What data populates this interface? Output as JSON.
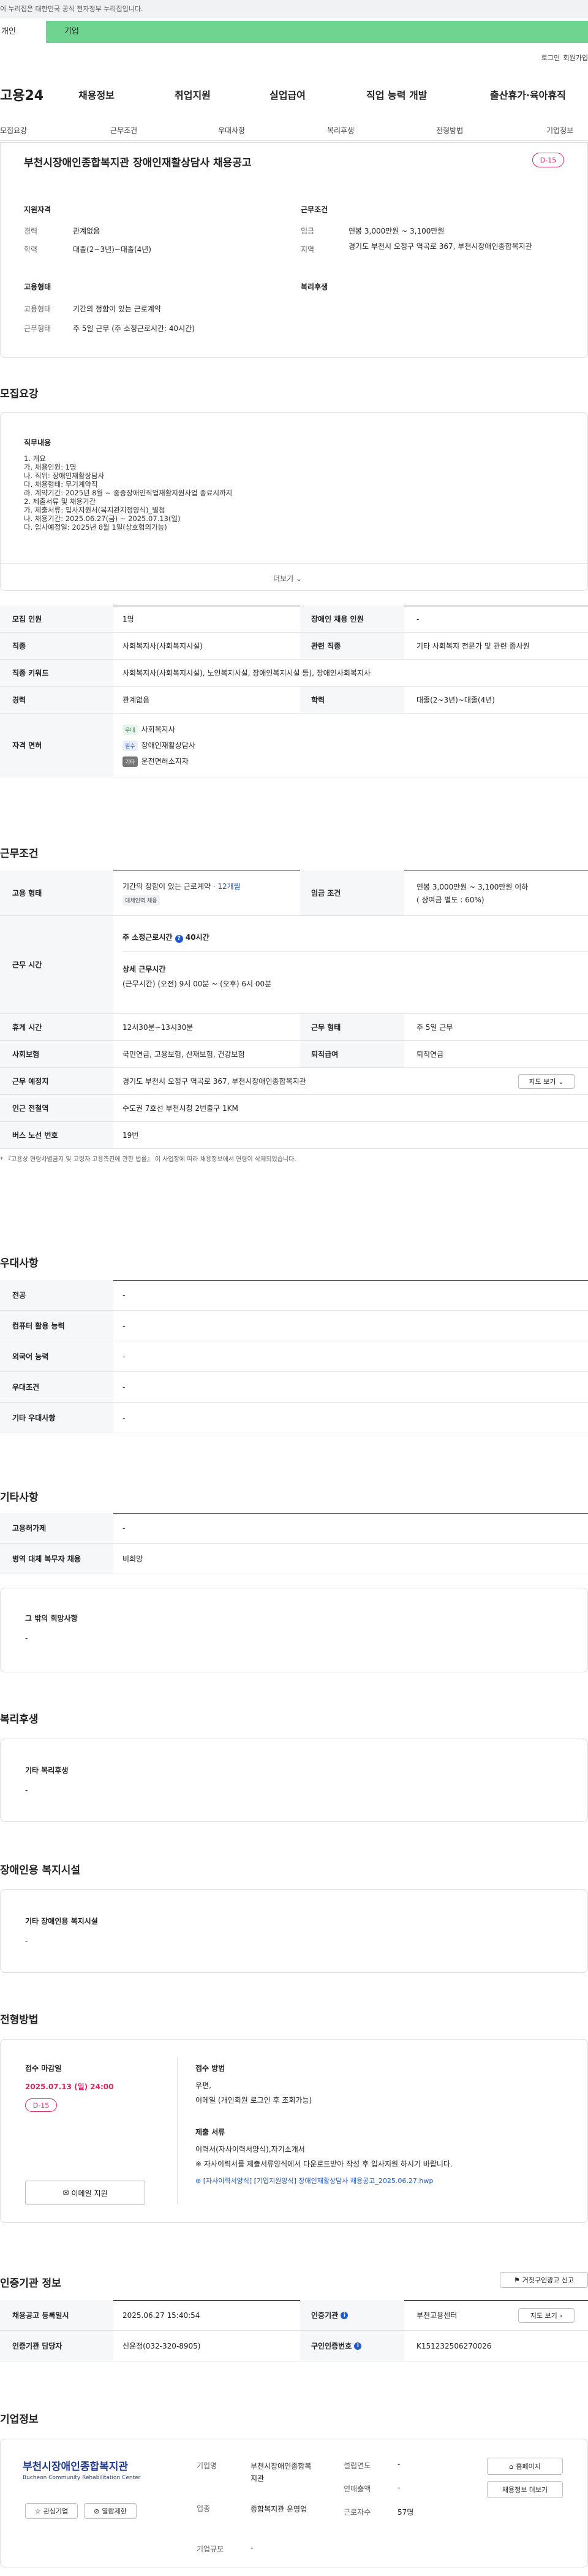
{
  "gov_banner": "이 누리집은 대한민국 공식 전자정부 누리집입니다.",
  "top_tabs": {
    "personal": "개인",
    "business": "기업"
  },
  "util": {
    "login": "로그인",
    "join": "회원가입"
  },
  "gnb": {
    "logo": "고용24",
    "menus": [
      "채용정보",
      "취업지원",
      "실업급여",
      "직업 능력 개발",
      "출산휴가·육아휴직"
    ]
  },
  "subnav": [
    "모집요강",
    "근무조건",
    "우대사항",
    "복리후생",
    "전형방법",
    "기업정보"
  ],
  "summary": {
    "title": "부천시장애인종합복지관 장애인재활상담사 채용공고",
    "dday": "D-15",
    "qual_head": "지원자격",
    "career_label": "경력",
    "career": "관계없음",
    "edu_label": "학력",
    "edu": "대졸(2~3년)~대졸(4년)",
    "cond_head": "근무조건",
    "wage_label": "임금",
    "wage": "연봉 3,000만원 ~ 3,100만원",
    "area_label": "지역",
    "area": "경기도 부천시 오정구 역곡로 367, 부천시장애인종합복지관",
    "type_head": "고용형태",
    "emp_label": "고용형태",
    "emp": "기간의 정함이 있는 근로계약",
    "work_label": "근무형태",
    "work": "주 5일 근무 (주 소정근로시간: 40시간)",
    "welfare_head": "복리후생"
  },
  "recruit": {
    "heading": "모집요강",
    "job_head": "직무내용",
    "lines": [
      "1. 개요",
      "가. 채용인원: 1명",
      "나. 직위: 장애인재활상담사",
      "다. 채용형태: 무기계약직",
      "라. 계약기간: 2025년 8월 ~ 중증장애인직업재활지원사업 종료시까지",
      "2. 제출서류 및 채용기간",
      "가. 제출서류: 입사지원서(복지관지정양식)_별첨",
      "나. 채용기간: 2025.06.27(금) ~ 2025.07.13(일)",
      "다. 입사예정일: 2025년 8월 1일(상호협의가능)"
    ],
    "more": "더보기",
    "rows": {
      "headcount_l": "모집 인원",
      "headcount": "1명",
      "disabled_l": "장애인 채용 인원",
      "disabled": "-",
      "job_l": "직종",
      "job": "사회복지사(사회복지시설)",
      "related_l": "관련 직종",
      "related": "기타 사회복지 전문가 및 관련 종사원",
      "kw_l": "직종 키워드",
      "kw": "사회복지사(사회복지시설), 노인복지시설, 장애인복지시설 등), 장애인사회복지사",
      "career_l": "경력",
      "career": "관계없음",
      "edu_l": "학력",
      "edu": "대졸(2~3년)~대졸(4년)",
      "cert_l": "자격 면허",
      "certs": [
        {
          "tag": "우대",
          "name": "사회복지사"
        },
        {
          "tag": "필수",
          "name": "장애인재활상담사"
        },
        {
          "tag": "기타",
          "name": "운전면허소지자"
        }
      ]
    }
  },
  "cond": {
    "heading": "근무조건",
    "emp_l": "고용 형태",
    "emp": "기간의 정함이 있는 근로계약 · ",
    "emp_m": "12개월",
    "emp_badge": "대체인력 채용",
    "wage_l": "임금 조건",
    "wage": "연봉 3,000만원 ~ 3,100만원 이하",
    "wage2": "( 상여금 별도 : 60%)",
    "time_l": "근무 시간",
    "time_h": "주 소정근로시간",
    "time_v": "40시간",
    "time_dh": "상세 근무시간",
    "time_d": "(근무시간) (오전) 9시 00분 ~ (오후) 6시 00분",
    "rest_l": "휴게 시간",
    "rest": "12시30분~13시30분",
    "form_l": "근무 형태",
    "form": "주 5일 근무",
    "ins_l": "사회보험",
    "ins": "국민연금, 고용보험, 산재보험, 건강보험",
    "sev_l": "퇴직급여",
    "sev": "퇴직연금",
    "loc_l": "근무 예정지",
    "loc": "경기도 부천시 오정구 역곡로 367, 부천시장애인종합복지관",
    "map": "지도 보기",
    "subway_l": "인근 전철역",
    "subway": "수도권 7호선 부천시청 2번출구 1KM",
    "bus_l": "버스 노선 번호",
    "bus": "19번",
    "note": "* 『고용상 연령차별금지 및 고령자 고용촉진에 관한 법률』 이 사업장에 따라 채용정보에서 연령이 삭제되었습니다."
  },
  "pref": {
    "heading": "우대사항",
    "rows": [
      {
        "l": "전공",
        "v": "-"
      },
      {
        "l": "컴퓨터 활용 능력",
        "v": "-"
      },
      {
        "l": "외국어 능력",
        "v": "-"
      },
      {
        "l": "우대조건",
        "v": "-"
      },
      {
        "l": "기타 우대사항",
        "v": "-"
      }
    ]
  },
  "etc": {
    "heading": "기타사항",
    "rows": [
      {
        "l": "고용허가제",
        "v": "-"
      },
      {
        "l": "병역 대체 복무자 채용",
        "v": "비희망"
      }
    ],
    "hope_h": "그 밖의 희망사항",
    "hope": "-"
  },
  "welfare": {
    "heading": "복리후생",
    "h": "기타 복리후생",
    "v": "-"
  },
  "facility": {
    "heading": "장애인용 복지시설",
    "h": "기타 장애인용 복지시설",
    "v": "-"
  },
  "method": {
    "heading": "전형방법",
    "deadline_h": "접수 마감일",
    "deadline": "2025.07.13 (일) 24:00",
    "dday": "D-15",
    "email_btn": "이메일 지원",
    "how_h": "접수 방법",
    "how1": "우편,",
    "how2": "이메일 (개인회원 로그인 후 조회가능)",
    "docs_h": "제출 서류",
    "docs1": "이력서(자사이력서양식),자기소개서",
    "docs2": "※ 자사이력서를 제출서류양식에서 다운로드받아 작성 후 입사지원 하시기 바랍니다.",
    "file": "[자사이력서양식] [기업지원양식] 장애인재활상담사 채용공고_2025.06.27.hwp"
  },
  "agency": {
    "heading": "인증기관 정보",
    "report": "거짓구인광고 신고",
    "reg_l": "채용공고 등록일시",
    "reg": "2025.06.27 15:40:54",
    "org_l": "인증기관",
    "org": "부천고용센터",
    "map": "지도 보기",
    "mgr_l": "인증기관 담당자",
    "mgr": "신윤정(032-320-8905)",
    "no_l": "구인인증번호",
    "no": "K151232506270026"
  },
  "company": {
    "heading": "기업정보",
    "logo": "부천시장애인종합복지관",
    "logo_en": "Bucheon Community Rehabilitation Center",
    "fav": "관심기업",
    "block": "열람제한",
    "name_l": "기업명",
    "name": "부천시장애인종합복지관",
    "est_l": "설립연도",
    "est": "-",
    "ind_l": "업종",
    "ind": "종합복지관 운영업",
    "sales_l": "연매출액",
    "sales": "-",
    "emp_l": "근로자수",
    "emp": "57명",
    "size_l": "기업규모",
    "size": "-",
    "home": "홈페이지",
    "jobs": "채용정보 더보기"
  }
}
